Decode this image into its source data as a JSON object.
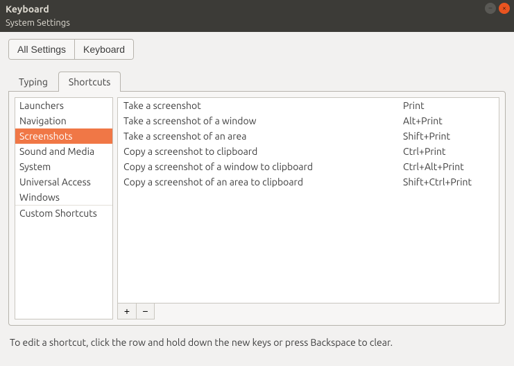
{
  "window": {
    "title": "Keyboard",
    "subtitle": "System Settings"
  },
  "breadcrumb": {
    "all_settings": "All Settings",
    "current": "Keyboard"
  },
  "tabs": {
    "typing": "Typing",
    "shortcuts": "Shortcuts",
    "active": "shortcuts"
  },
  "categories": {
    "items": [
      "Launchers",
      "Navigation",
      "Screenshots",
      "Sound and Media",
      "System",
      "Universal Access",
      "Windows"
    ],
    "custom": "Custom Shortcuts",
    "selected_index": 2
  },
  "shortcuts": [
    {
      "desc": "Take a screenshot",
      "keys": "Print"
    },
    {
      "desc": "Take a screenshot of a window",
      "keys": "Alt+Print"
    },
    {
      "desc": "Take a screenshot of an area",
      "keys": "Shift+Print"
    },
    {
      "desc": "Copy a screenshot to clipboard",
      "keys": "Ctrl+Print"
    },
    {
      "desc": "Copy a screenshot of a window to clipboard",
      "keys": "Ctrl+Alt+Print"
    },
    {
      "desc": "Copy a screenshot of an area to clipboard",
      "keys": "Shift+Ctrl+Print"
    }
  ],
  "buttons": {
    "add": "+",
    "remove": "−"
  },
  "hint": "To edit a shortcut, click the row and hold down the new keys or press Backspace to clear."
}
